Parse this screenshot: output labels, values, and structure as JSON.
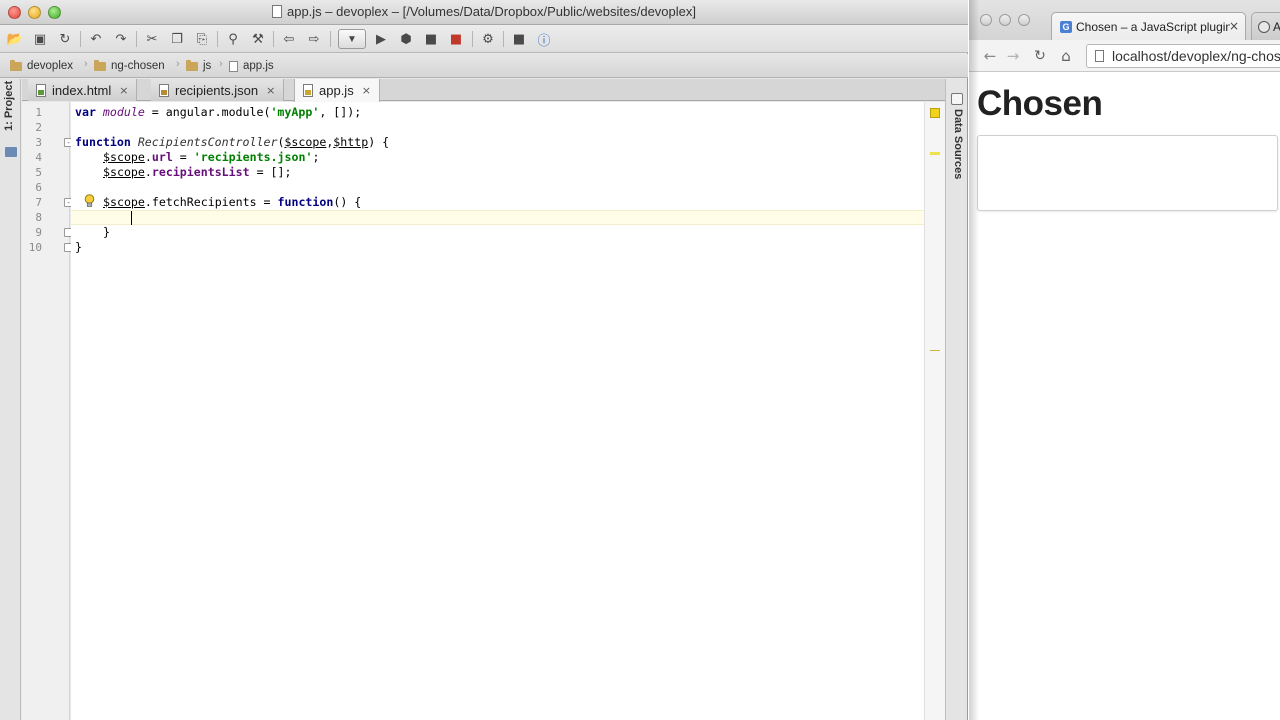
{
  "ide": {
    "title": "app.js – devoplex – [/Volumes/Data/Dropbox/Public/websites/devoplex]",
    "breadcrumbs": [
      "devoplex",
      "ng-chosen",
      "js",
      "app.js"
    ],
    "left_tool_window": "1: Project",
    "right_tool_window": "Data Sources",
    "tabs": [
      {
        "label": "index.html",
        "close": "×"
      },
      {
        "label": "recipients.json",
        "close": "×"
      },
      {
        "label": "app.js",
        "close": "×"
      }
    ],
    "active_tab": "app.js",
    "line_numbers": [
      "1",
      "2",
      "3",
      "4",
      "5",
      "6",
      "7",
      "8",
      "9",
      "10"
    ],
    "code": {
      "l1": {
        "a": "var ",
        "b": "module",
        "c": " = angular.module(",
        "d": "'myApp'",
        "e": ", []);"
      },
      "l3": {
        "a": "function ",
        "b": "RecipientsController",
        "c": "(",
        "d": "$scope",
        "e": ",",
        "f": "$http",
        "g": ") {"
      },
      "l4": {
        "a": "$scope",
        "b": ".",
        "c": "url",
        "d": " = ",
        "e": "'recipients.json'",
        "f": ";"
      },
      "l5": {
        "a": "$scope",
        "b": ".",
        "c": "recipientsList",
        "d": " = [];"
      },
      "l7": {
        "a": "$scope",
        "b": ".fetchRecipients = ",
        "c": "function",
        "d": "() {"
      },
      "l9": "}",
      "l10": "}"
    },
    "accent_keyword_color": "#000080",
    "accent_string_color": "#008000"
  },
  "browser": {
    "tab_title": "Chosen – a JavaScript plugin",
    "tab_close": "×",
    "second_tab_label": "A",
    "url": "localhost/devoplex/ng-chosen",
    "page_heading": "Chosen"
  },
  "icons": {
    "tab_favicon": "G",
    "bulb": "lightbulb-icon"
  }
}
